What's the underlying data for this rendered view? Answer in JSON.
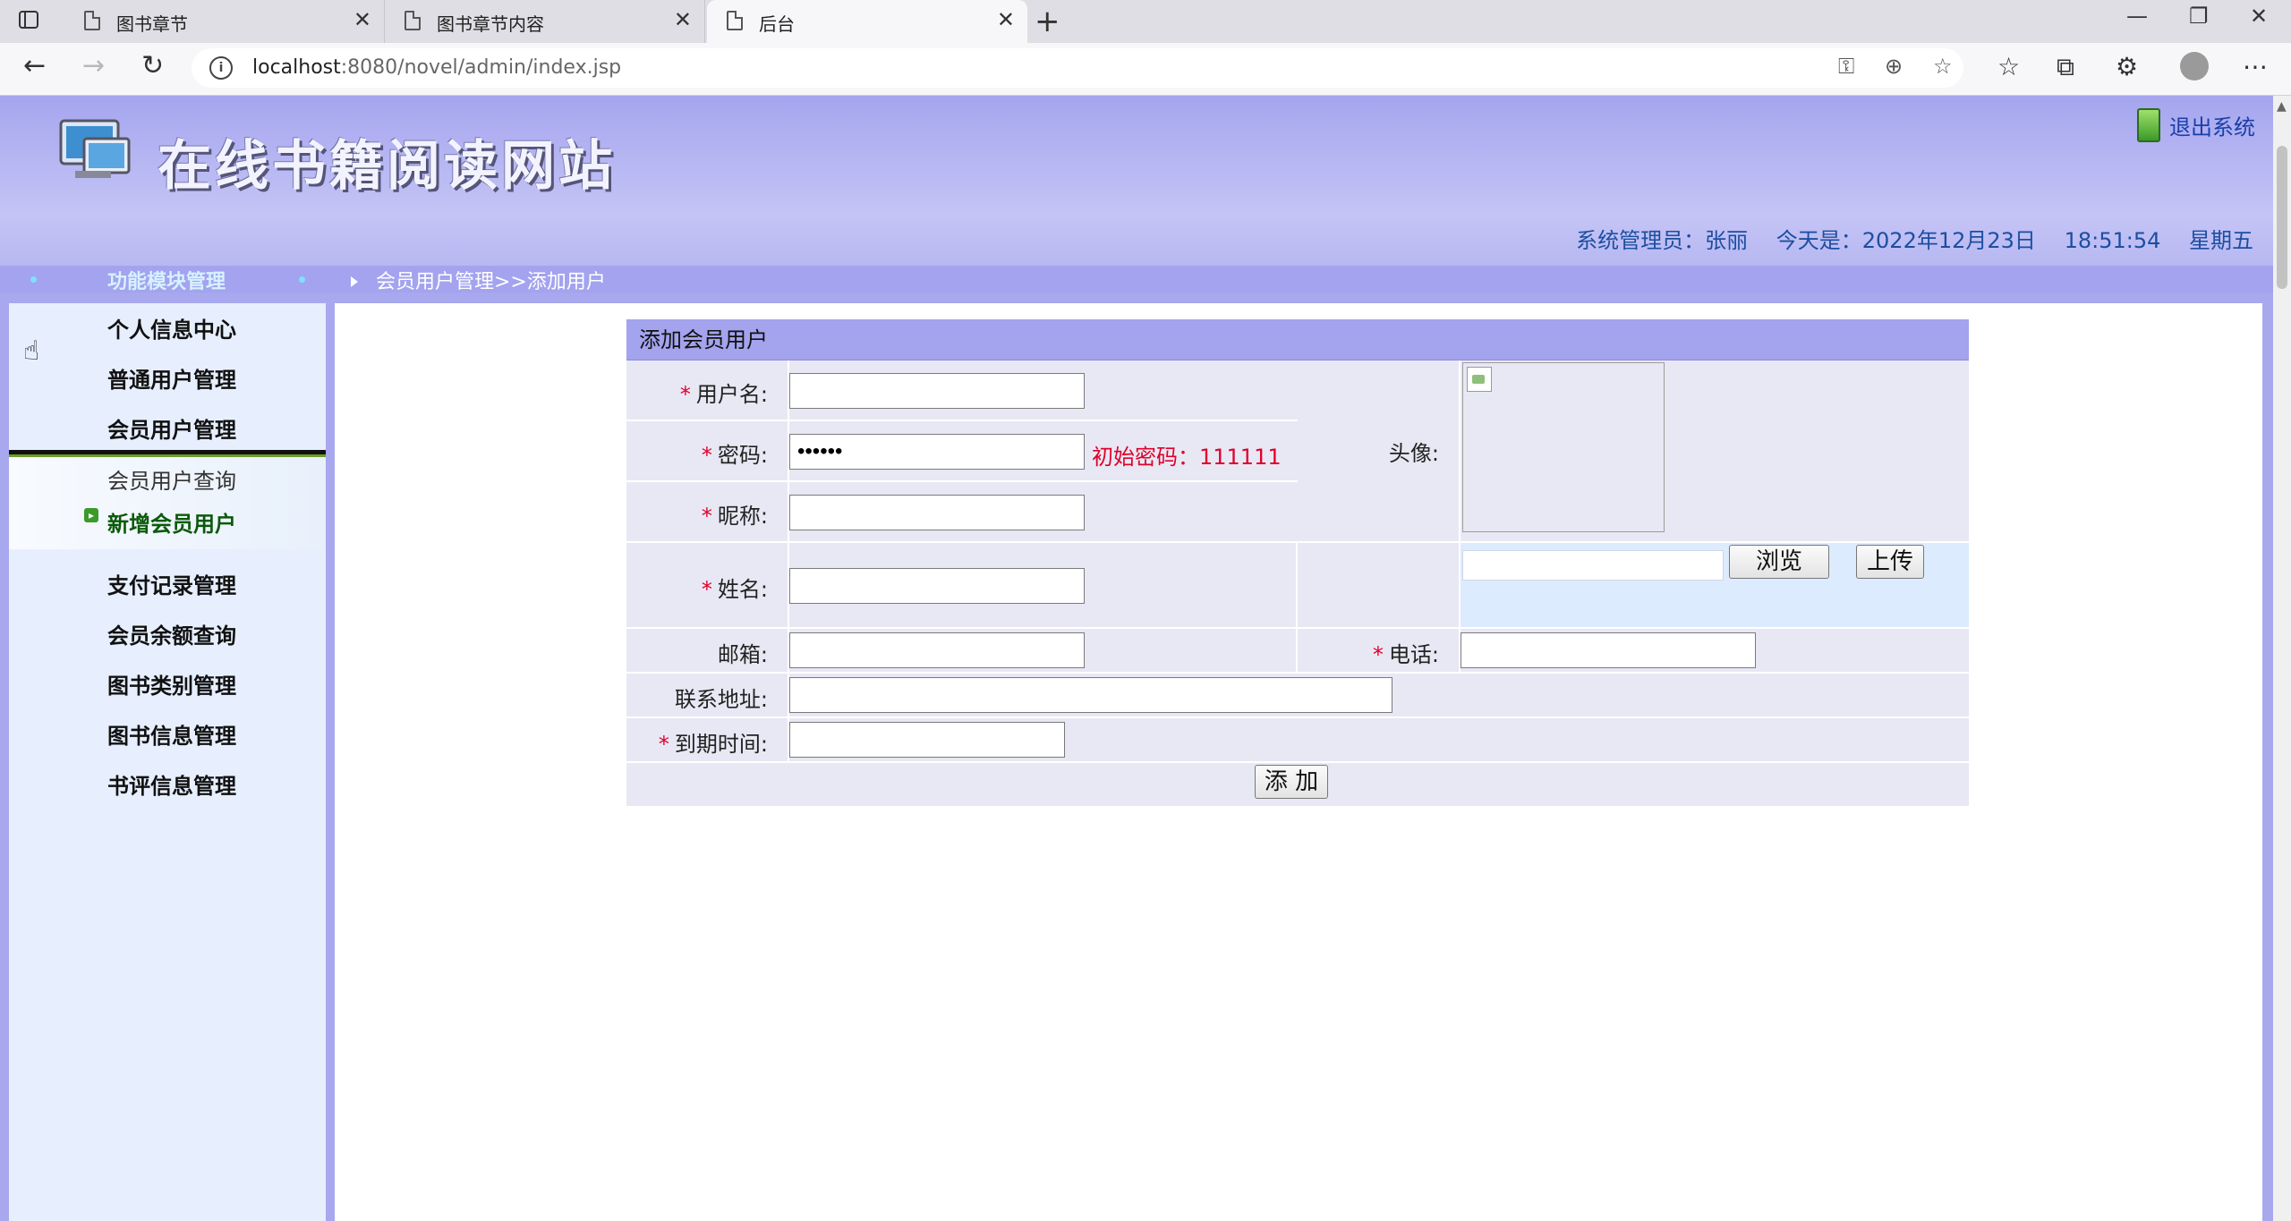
{
  "browser": {
    "tabs": [
      {
        "label": "图书章节"
      },
      {
        "label": "图书章节内容"
      },
      {
        "label": "后台"
      }
    ],
    "url_host": "localhost",
    "url_rest": ":8080/novel/admin/index.jsp"
  },
  "header": {
    "site_title": "在线书籍阅读网站",
    "logout": "退出系统",
    "admin_label": "系统管理员：张丽",
    "date_label": "今天是：2022年12月23日",
    "time": "18:51:54",
    "weekday": "星期五"
  },
  "breadbar": {
    "module_title": "功能模块管理",
    "crumb": "会员用户管理>>添加用户"
  },
  "sidebar": {
    "items": [
      {
        "label": "个人信息中心"
      },
      {
        "label": "普通用户管理"
      },
      {
        "label": "会员用户管理"
      },
      {
        "label": "支付记录管理"
      },
      {
        "label": "会员余额查询"
      },
      {
        "label": "图书类别管理"
      },
      {
        "label": "图书信息管理"
      },
      {
        "label": "书评信息管理"
      }
    ],
    "subitems": [
      {
        "label": "会员用户查询"
      },
      {
        "label": "新增会员用户"
      }
    ]
  },
  "form": {
    "title": "添加会员用户",
    "username_label": "用户名:",
    "password_label": "密码:",
    "password_value": "••••••",
    "password_hint": "初始密码：111111",
    "nickname_label": "昵称:",
    "realname_label": "姓名:",
    "avatar_label": "头像:",
    "email_label": "邮箱:",
    "phone_label": "电话:",
    "address_label": "联系地址:",
    "expire_label": "到期时间:",
    "browse_button": "浏览",
    "upload_button": "上传",
    "submit_button": "添 加",
    "required_mark": "*"
  }
}
